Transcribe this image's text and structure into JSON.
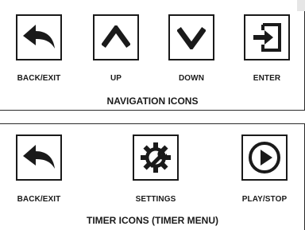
{
  "navigation": {
    "title": "NAVIGATION ICONS",
    "items": [
      {
        "label": "BACK/EXIT",
        "icon": "back-arrow-icon"
      },
      {
        "label": "UP",
        "icon": "chevron-up-icon"
      },
      {
        "label": "DOWN",
        "icon": "chevron-down-icon"
      },
      {
        "label": "ENTER",
        "icon": "enter-icon"
      }
    ]
  },
  "timer": {
    "title": "TIMER ICONS (TIMER MENU)",
    "items": [
      {
        "label": "BACK/EXIT",
        "icon": "back-arrow-icon"
      },
      {
        "label": "SETTINGS",
        "icon": "settings-gear-wrench-icon"
      },
      {
        "label": "PLAY/STOP",
        "icon": "play-circle-icon"
      }
    ]
  },
  "colors": {
    "border": "#1a1a1a",
    "background": "#ffffff"
  }
}
